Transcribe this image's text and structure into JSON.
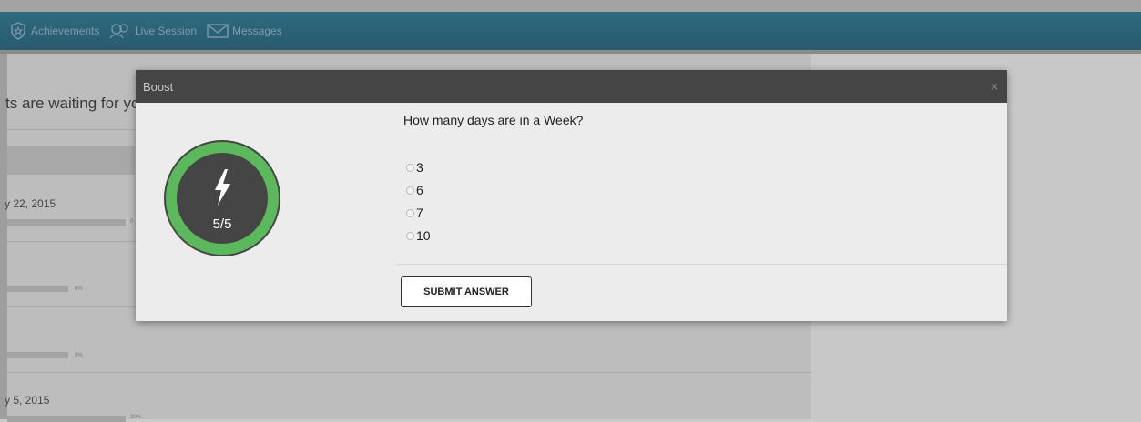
{
  "nav": {
    "achievements": "Achievements",
    "live_session": "Live Session",
    "messages": "Messages"
  },
  "background": {
    "heading": "ts are waiting for yo",
    "date1": "y 22, 2015",
    "pct1": "0",
    "pct2": "0%",
    "pct3": "3%",
    "date2": "y 5, 2015",
    "pct4": "20%"
  },
  "modal": {
    "title": "Boost",
    "close": "×",
    "boost_count": "5/5",
    "boost_progress": 1.0,
    "question": "How many days are in a Week?",
    "options": [
      "3",
      "6",
      "7",
      "10"
    ],
    "submit_label": "SUBMIT ANSWER"
  },
  "colors": {
    "navbar": "#2f6a80",
    "ring_green": "#5cb85c",
    "ring_dark": "#454545"
  }
}
